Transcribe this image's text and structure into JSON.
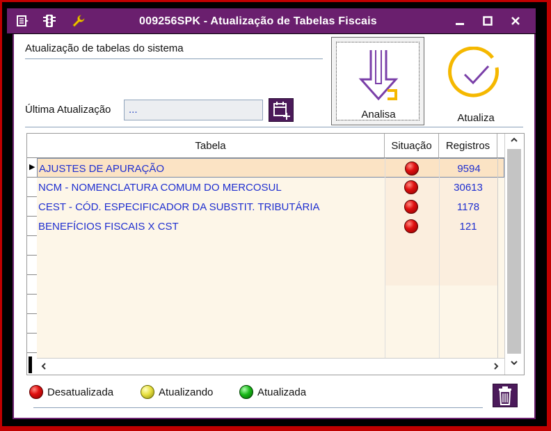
{
  "window": {
    "title": "009256SPK - Atualização de Tabelas Fiscais",
    "icons": [
      "menu-icon",
      "traffic-light-icon",
      "wrench-icon"
    ],
    "controls": [
      "minimize-icon",
      "maximize-icon",
      "close-icon"
    ]
  },
  "section": {
    "label": "Atualização de tabelas do sistema"
  },
  "last_update": {
    "label": "Última Atualização",
    "value": "..."
  },
  "buttons": {
    "analisa": "Analisa",
    "atualiza": "Atualiza"
  },
  "grid": {
    "columns": [
      "Tabela",
      "Situação",
      "Registros"
    ],
    "rows": [
      {
        "tabela": "AJUSTES DE APURAÇÃO",
        "situacao": "desatualizada",
        "registros": "9594"
      },
      {
        "tabela": "NCM - NOMENCLATURA COMUM DO MERCOSUL",
        "situacao": "desatualizada",
        "registros": "30613"
      },
      {
        "tabela": "CEST - CÓD. ESPECIFICADOR DA SUBSTIT. TRIBUTÁRIA",
        "situacao": "desatualizada",
        "registros": "1178"
      },
      {
        "tabela": "BENEFÍCIOS FISCAIS X CST",
        "situacao": "desatualizada",
        "registros": "121"
      }
    ],
    "selected_row": 0
  },
  "legend": [
    {
      "label": "Desatualizada",
      "color": "#e01010"
    },
    {
      "label": "Atualizando",
      "color": "#e8e040"
    },
    {
      "label": "Atualizada",
      "color": "#18b818"
    }
  ],
  "colors": {
    "title_bar": "#6a1f6e",
    "frame": "#c00000",
    "row_text": "#1f2fd0",
    "accent": "#4b1a5a",
    "button_arrow": "#7a3fa8",
    "button_highlight": "#f5b800"
  }
}
